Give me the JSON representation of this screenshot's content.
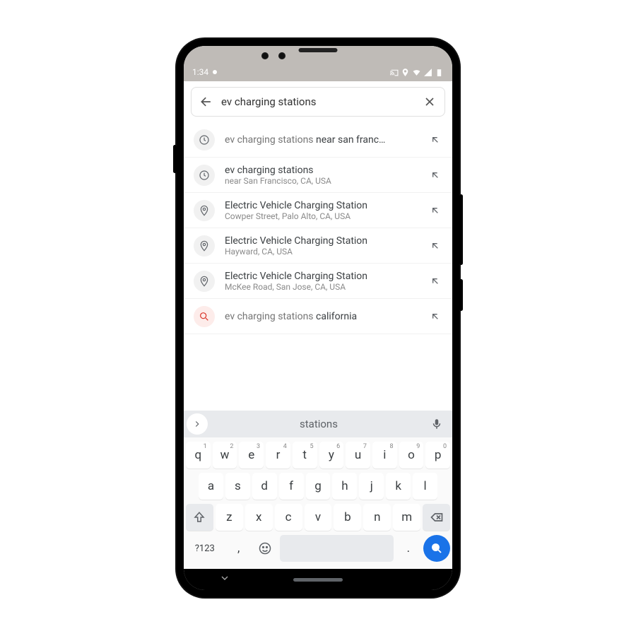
{
  "status": {
    "time": "1:34"
  },
  "search": {
    "value": "ev charging stations"
  },
  "suggestions": [
    {
      "icon": "clock",
      "prefix": "ev charging stations ",
      "bold": "near san franc…",
      "sub": ""
    },
    {
      "icon": "clock",
      "prefix": "",
      "bold": "ev charging stations",
      "sub": "near San Francisco, CA, USA"
    },
    {
      "icon": "pin",
      "prefix": "",
      "bold": "Electric Vehicle Charging Station",
      "sub": "Cowper Street, Palo Alto, CA, USA"
    },
    {
      "icon": "pin",
      "prefix": "",
      "bold": "Electric Vehicle Charging Station",
      "sub": "Hayward, CA, USA"
    },
    {
      "icon": "pin",
      "prefix": "",
      "bold": "Electric Vehicle Charging Station",
      "sub": "McKee Road, San Jose, CA, USA"
    },
    {
      "icon": "search",
      "prefix": "ev charging stations ",
      "bold": "california",
      "sub": ""
    }
  ],
  "keyboard": {
    "prediction": "stations",
    "row1": [
      {
        "k": "q",
        "n": "1"
      },
      {
        "k": "w",
        "n": "2"
      },
      {
        "k": "e",
        "n": "3"
      },
      {
        "k": "r",
        "n": "4"
      },
      {
        "k": "t",
        "n": "5"
      },
      {
        "k": "y",
        "n": "6"
      },
      {
        "k": "u",
        "n": "7"
      },
      {
        "k": "i",
        "n": "8"
      },
      {
        "k": "o",
        "n": "9"
      },
      {
        "k": "p",
        "n": "0"
      }
    ],
    "row2": [
      "a",
      "s",
      "d",
      "f",
      "g",
      "h",
      "j",
      "k",
      "l"
    ],
    "row3": [
      "z",
      "x",
      "c",
      "v",
      "b",
      "n",
      "m"
    ],
    "q123": "?123",
    "comma": ",",
    "dot": "."
  }
}
